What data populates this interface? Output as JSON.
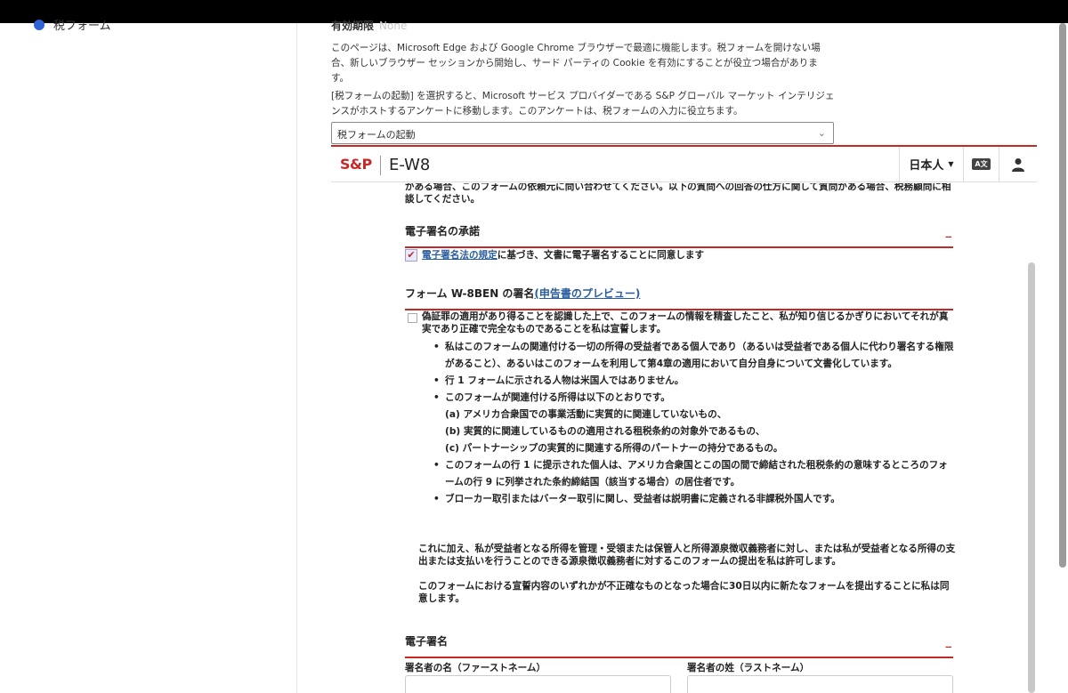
{
  "left_panel": {
    "item_label": "税フォーム"
  },
  "main": {
    "expiry_label": "有効期限",
    "expiry_value": "None",
    "para1": "このページは、Microsoft Edge および Google Chrome ブラウザーで最適に機能します。税フォームを開けない場合、新しいブラウザー セッションから開始し、サード パーティの Cookie を有効にすることが役立つ場合があります。",
    "para2": "[税フォームの起動] を選択すると、Microsoft サービス プロバイダーである S&P グローバル マーケット インテリジェンスがホストするアンケートに移動します。このアンケートは、税フォームの入力に役立ちます。",
    "select_value": "税フォームの起動"
  },
  "frame": {
    "logo": "S&P",
    "form_title": "E-W8",
    "language": "日本人",
    "translate_icon_text": "A文",
    "intro_text": "がある場合、このフォームの依頼元に問い合わせてください。以下の質問への回答の仕方に関して質問がある場合、税務顧問に相談してください。",
    "section1_title": "電子署名の承諾",
    "section_collapse": "_",
    "consent_link": "電子署名法の規定",
    "consent_text": "に基づき、文書に電子署名することに同意します",
    "section2_title": "フォーム W-8BEN の署名",
    "preview_link": "(申告書のプレビュー)",
    "declaration": "偽証罪の適用があり得ることを認識した上で、このフォームの情報を精査したこと、私が知り信じるかぎりにおいてそれが真実であり正確で完全なものであることを私は宣誓します。",
    "bullets": [
      "私はこのフォームの関連付ける一切の所得の受益者である個人であり（あるいは受益者である個人に代わり署名する権限があること）、あるいはこのフォームを利用して第4章の適用において自分自身について文書化しています。",
      "行 1 フォームに示される人物は米国人ではありません。",
      "このフォームが関連付ける所得は以下のとおりです。"
    ],
    "sub_items": [
      "(a) アメリカ合衆国での事業活動に実質的に関連していないもの、",
      "(b) 実質的に関連しているものの適用される租税条約の対象外であるもの、",
      "(c) パートナーシップの実質的に関連する所得のパートナーの持分であるもの。"
    ],
    "bullets2": [
      "このフォームの行 1 に提示された個人は、アメリカ合衆国とこの国の間で締結された租税条約の意味するところのフォームの行 9 に列挙された条約締結国（該当する場合）の居住者です。",
      "ブローカー取引またはバーター取引に関し、受益者は説明書に定義される非課税外国人です。"
    ],
    "extra1": "これに加え、私が受益者となる所得を管理・受領または保管人と所得源泉徴収義務者に対し、または私が受益者となる所得の支出または支払いを行うことのできる源泉徴収義務者に対するこのフォームの提出を私は許可します。",
    "extra2": "このフォームにおける宣誓内容のいずれかが不正確なものとなった場合に30日以内に新たなフォームを提出することに私は同意します。",
    "section3_title": "電子署名",
    "first_name_label": "署名者の名（ファーストネーム）",
    "last_name_label": "署名者の姓（ラストネーム）"
  },
  "colors": {
    "accent": "#c62828",
    "link": "#2a5d9f",
    "radio": "#2f64d6"
  }
}
